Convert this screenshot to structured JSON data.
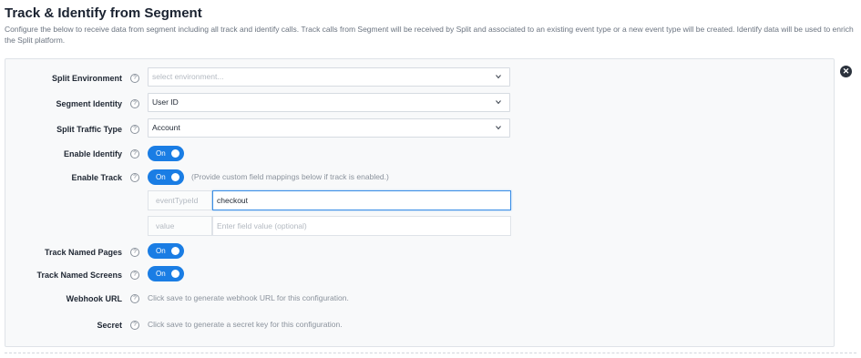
{
  "header": {
    "title": "Track & Identify from Segment",
    "description": "Configure the below to receive data from segment including all track and identify calls. Track calls from Segment will be received by Split and associated to an existing event type or a new event type will be created. Identify data will be used to enrich the Split platform."
  },
  "help_glyph": "?",
  "close_glyph": "✕",
  "fields": {
    "environment": {
      "label": "Split Environment",
      "placeholder": "select environment..."
    },
    "segment_identity": {
      "label": "Segment Identity",
      "value": "User ID"
    },
    "traffic_type": {
      "label": "Split Traffic Type",
      "value": "Account"
    },
    "enable_identify": {
      "label": "Enable Identify",
      "toggle": "On"
    },
    "enable_track": {
      "label": "Enable Track",
      "toggle": "On",
      "note": "(Provide custom field mappings below if track is enabled.)"
    },
    "mapping_event": {
      "key_placeholder": "eventTypeId",
      "value": "checkout"
    },
    "mapping_value": {
      "key_placeholder": "value",
      "value_placeholder": "Enter field value (optional)"
    },
    "track_named_pages": {
      "label": "Track Named Pages",
      "toggle": "On"
    },
    "track_named_screens": {
      "label": "Track Named Screens",
      "toggle": "On"
    },
    "webhook_url": {
      "label": "Webhook URL",
      "note": "Click save to generate webhook URL for this configuration."
    },
    "secret": {
      "label": "Secret",
      "note": "Click save to generate a secret key for this configuration."
    }
  },
  "colors": {
    "toggle_on": "#1a7de4",
    "focus_border": "#3a8ee6",
    "panel_bg": "#f8f9fa"
  }
}
